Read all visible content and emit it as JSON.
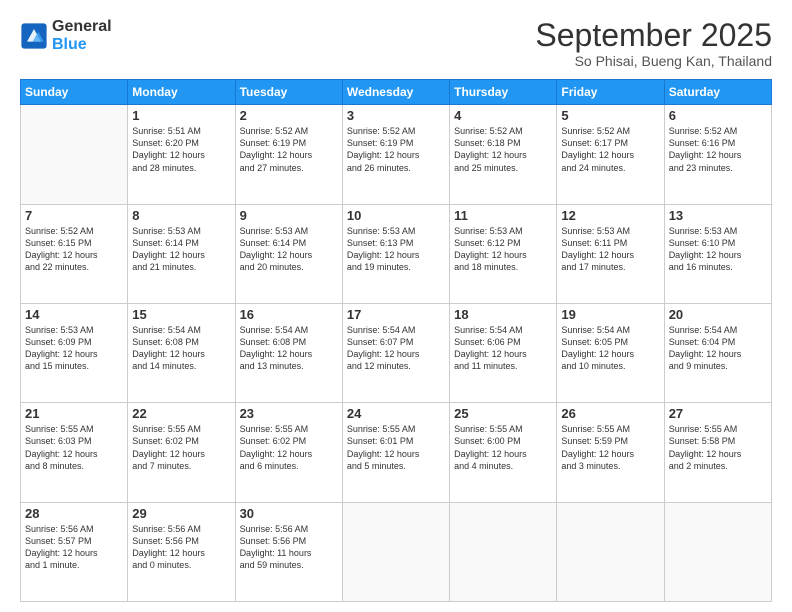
{
  "header": {
    "logo_line1": "General",
    "logo_line2": "Blue",
    "title": "September 2025",
    "subtitle": "So Phisai, Bueng Kan, Thailand"
  },
  "days_of_week": [
    "Sunday",
    "Monday",
    "Tuesday",
    "Wednesday",
    "Thursday",
    "Friday",
    "Saturday"
  ],
  "weeks": [
    [
      {
        "day": "",
        "info": ""
      },
      {
        "day": "1",
        "info": "Sunrise: 5:51 AM\nSunset: 6:20 PM\nDaylight: 12 hours\nand 28 minutes."
      },
      {
        "day": "2",
        "info": "Sunrise: 5:52 AM\nSunset: 6:19 PM\nDaylight: 12 hours\nand 27 minutes."
      },
      {
        "day": "3",
        "info": "Sunrise: 5:52 AM\nSunset: 6:19 PM\nDaylight: 12 hours\nand 26 minutes."
      },
      {
        "day": "4",
        "info": "Sunrise: 5:52 AM\nSunset: 6:18 PM\nDaylight: 12 hours\nand 25 minutes."
      },
      {
        "day": "5",
        "info": "Sunrise: 5:52 AM\nSunset: 6:17 PM\nDaylight: 12 hours\nand 24 minutes."
      },
      {
        "day": "6",
        "info": "Sunrise: 5:52 AM\nSunset: 6:16 PM\nDaylight: 12 hours\nand 23 minutes."
      }
    ],
    [
      {
        "day": "7",
        "info": "Sunrise: 5:52 AM\nSunset: 6:15 PM\nDaylight: 12 hours\nand 22 minutes."
      },
      {
        "day": "8",
        "info": "Sunrise: 5:53 AM\nSunset: 6:14 PM\nDaylight: 12 hours\nand 21 minutes."
      },
      {
        "day": "9",
        "info": "Sunrise: 5:53 AM\nSunset: 6:14 PM\nDaylight: 12 hours\nand 20 minutes."
      },
      {
        "day": "10",
        "info": "Sunrise: 5:53 AM\nSunset: 6:13 PM\nDaylight: 12 hours\nand 19 minutes."
      },
      {
        "day": "11",
        "info": "Sunrise: 5:53 AM\nSunset: 6:12 PM\nDaylight: 12 hours\nand 18 minutes."
      },
      {
        "day": "12",
        "info": "Sunrise: 5:53 AM\nSunset: 6:11 PM\nDaylight: 12 hours\nand 17 minutes."
      },
      {
        "day": "13",
        "info": "Sunrise: 5:53 AM\nSunset: 6:10 PM\nDaylight: 12 hours\nand 16 minutes."
      }
    ],
    [
      {
        "day": "14",
        "info": "Sunrise: 5:53 AM\nSunset: 6:09 PM\nDaylight: 12 hours\nand 15 minutes."
      },
      {
        "day": "15",
        "info": "Sunrise: 5:54 AM\nSunset: 6:08 PM\nDaylight: 12 hours\nand 14 minutes."
      },
      {
        "day": "16",
        "info": "Sunrise: 5:54 AM\nSunset: 6:08 PM\nDaylight: 12 hours\nand 13 minutes."
      },
      {
        "day": "17",
        "info": "Sunrise: 5:54 AM\nSunset: 6:07 PM\nDaylight: 12 hours\nand 12 minutes."
      },
      {
        "day": "18",
        "info": "Sunrise: 5:54 AM\nSunset: 6:06 PM\nDaylight: 12 hours\nand 11 minutes."
      },
      {
        "day": "19",
        "info": "Sunrise: 5:54 AM\nSunset: 6:05 PM\nDaylight: 12 hours\nand 10 minutes."
      },
      {
        "day": "20",
        "info": "Sunrise: 5:54 AM\nSunset: 6:04 PM\nDaylight: 12 hours\nand 9 minutes."
      }
    ],
    [
      {
        "day": "21",
        "info": "Sunrise: 5:55 AM\nSunset: 6:03 PM\nDaylight: 12 hours\nand 8 minutes."
      },
      {
        "day": "22",
        "info": "Sunrise: 5:55 AM\nSunset: 6:02 PM\nDaylight: 12 hours\nand 7 minutes."
      },
      {
        "day": "23",
        "info": "Sunrise: 5:55 AM\nSunset: 6:02 PM\nDaylight: 12 hours\nand 6 minutes."
      },
      {
        "day": "24",
        "info": "Sunrise: 5:55 AM\nSunset: 6:01 PM\nDaylight: 12 hours\nand 5 minutes."
      },
      {
        "day": "25",
        "info": "Sunrise: 5:55 AM\nSunset: 6:00 PM\nDaylight: 12 hours\nand 4 minutes."
      },
      {
        "day": "26",
        "info": "Sunrise: 5:55 AM\nSunset: 5:59 PM\nDaylight: 12 hours\nand 3 minutes."
      },
      {
        "day": "27",
        "info": "Sunrise: 5:55 AM\nSunset: 5:58 PM\nDaylight: 12 hours\nand 2 minutes."
      }
    ],
    [
      {
        "day": "28",
        "info": "Sunrise: 5:56 AM\nSunset: 5:57 PM\nDaylight: 12 hours\nand 1 minute."
      },
      {
        "day": "29",
        "info": "Sunrise: 5:56 AM\nSunset: 5:56 PM\nDaylight: 12 hours\nand 0 minutes."
      },
      {
        "day": "30",
        "info": "Sunrise: 5:56 AM\nSunset: 5:56 PM\nDaylight: 11 hours\nand 59 minutes."
      },
      {
        "day": "",
        "info": ""
      },
      {
        "day": "",
        "info": ""
      },
      {
        "day": "",
        "info": ""
      },
      {
        "day": "",
        "info": ""
      }
    ]
  ]
}
